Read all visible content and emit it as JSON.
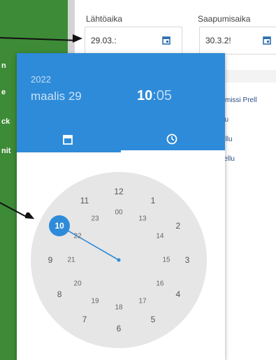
{
  "sidebar_fragments": [
    "n",
    "e",
    "ck",
    "nit"
  ],
  "form": {
    "departure": {
      "label": "Lähtöaika",
      "value": "29.03.:"
    },
    "arrival": {
      "label": "Saapumisaika",
      "value": "30.3.2!"
    }
  },
  "list_fragments": [
    "ymissi Prell",
    "llu",
    "ellu",
    "rellu"
  ],
  "picker": {
    "year": "2022",
    "date": "maalis 29",
    "hours": "10",
    "separator": ":",
    "minutes": "05",
    "tabs": [
      "calendar-icon",
      "clock-icon"
    ],
    "outer_numbers": [
      "12",
      "1",
      "2",
      "3",
      "4",
      "5",
      "6",
      "7",
      "8",
      "9",
      "10",
      "11"
    ],
    "inner_numbers": [
      "00",
      "13",
      "14",
      "15",
      "16",
      "17",
      "18",
      "19",
      "20",
      "21",
      "22",
      "23"
    ],
    "selected_hour": "10"
  },
  "colors": {
    "primary": "#2e8bd9",
    "green": "#3d8b36",
    "face": "#e6e6e6"
  }
}
